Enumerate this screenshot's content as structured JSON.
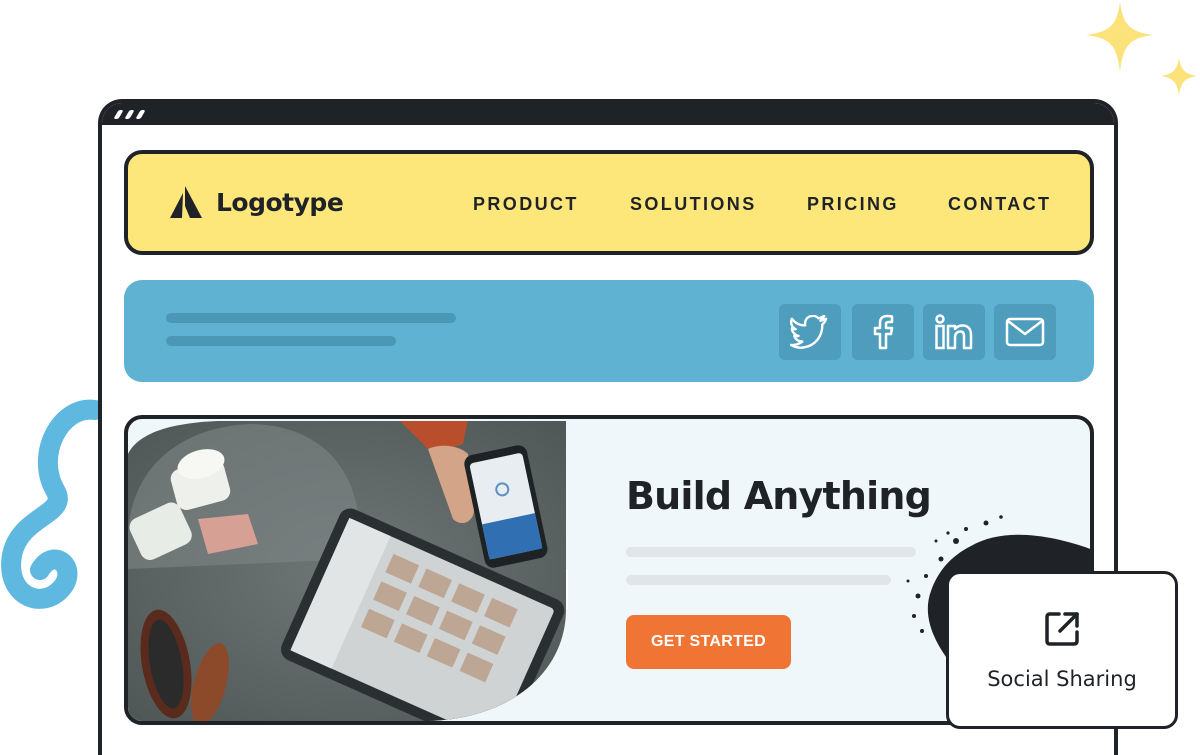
{
  "brand": {
    "logo_text": "Logotype",
    "logo_icon": "triangle-logo-icon",
    "colors": {
      "nav_bg": "#fde77a",
      "share_bg": "#5fb2d1",
      "cta": "#f07434",
      "ink": "#1f2328"
    }
  },
  "nav": {
    "items": [
      {
        "label": "PRODUCT"
      },
      {
        "label": "SOLUTIONS"
      },
      {
        "label": "PRICING"
      },
      {
        "label": "CONTACT"
      }
    ]
  },
  "share_bar": {
    "icons": [
      "twitter-icon",
      "facebook-icon",
      "linkedin-icon",
      "mail-icon"
    ]
  },
  "hero": {
    "title": "Build Anything",
    "cta_label": "GET STARTED"
  },
  "social_card": {
    "icon": "external-link-icon",
    "label": "Social Sharing"
  }
}
